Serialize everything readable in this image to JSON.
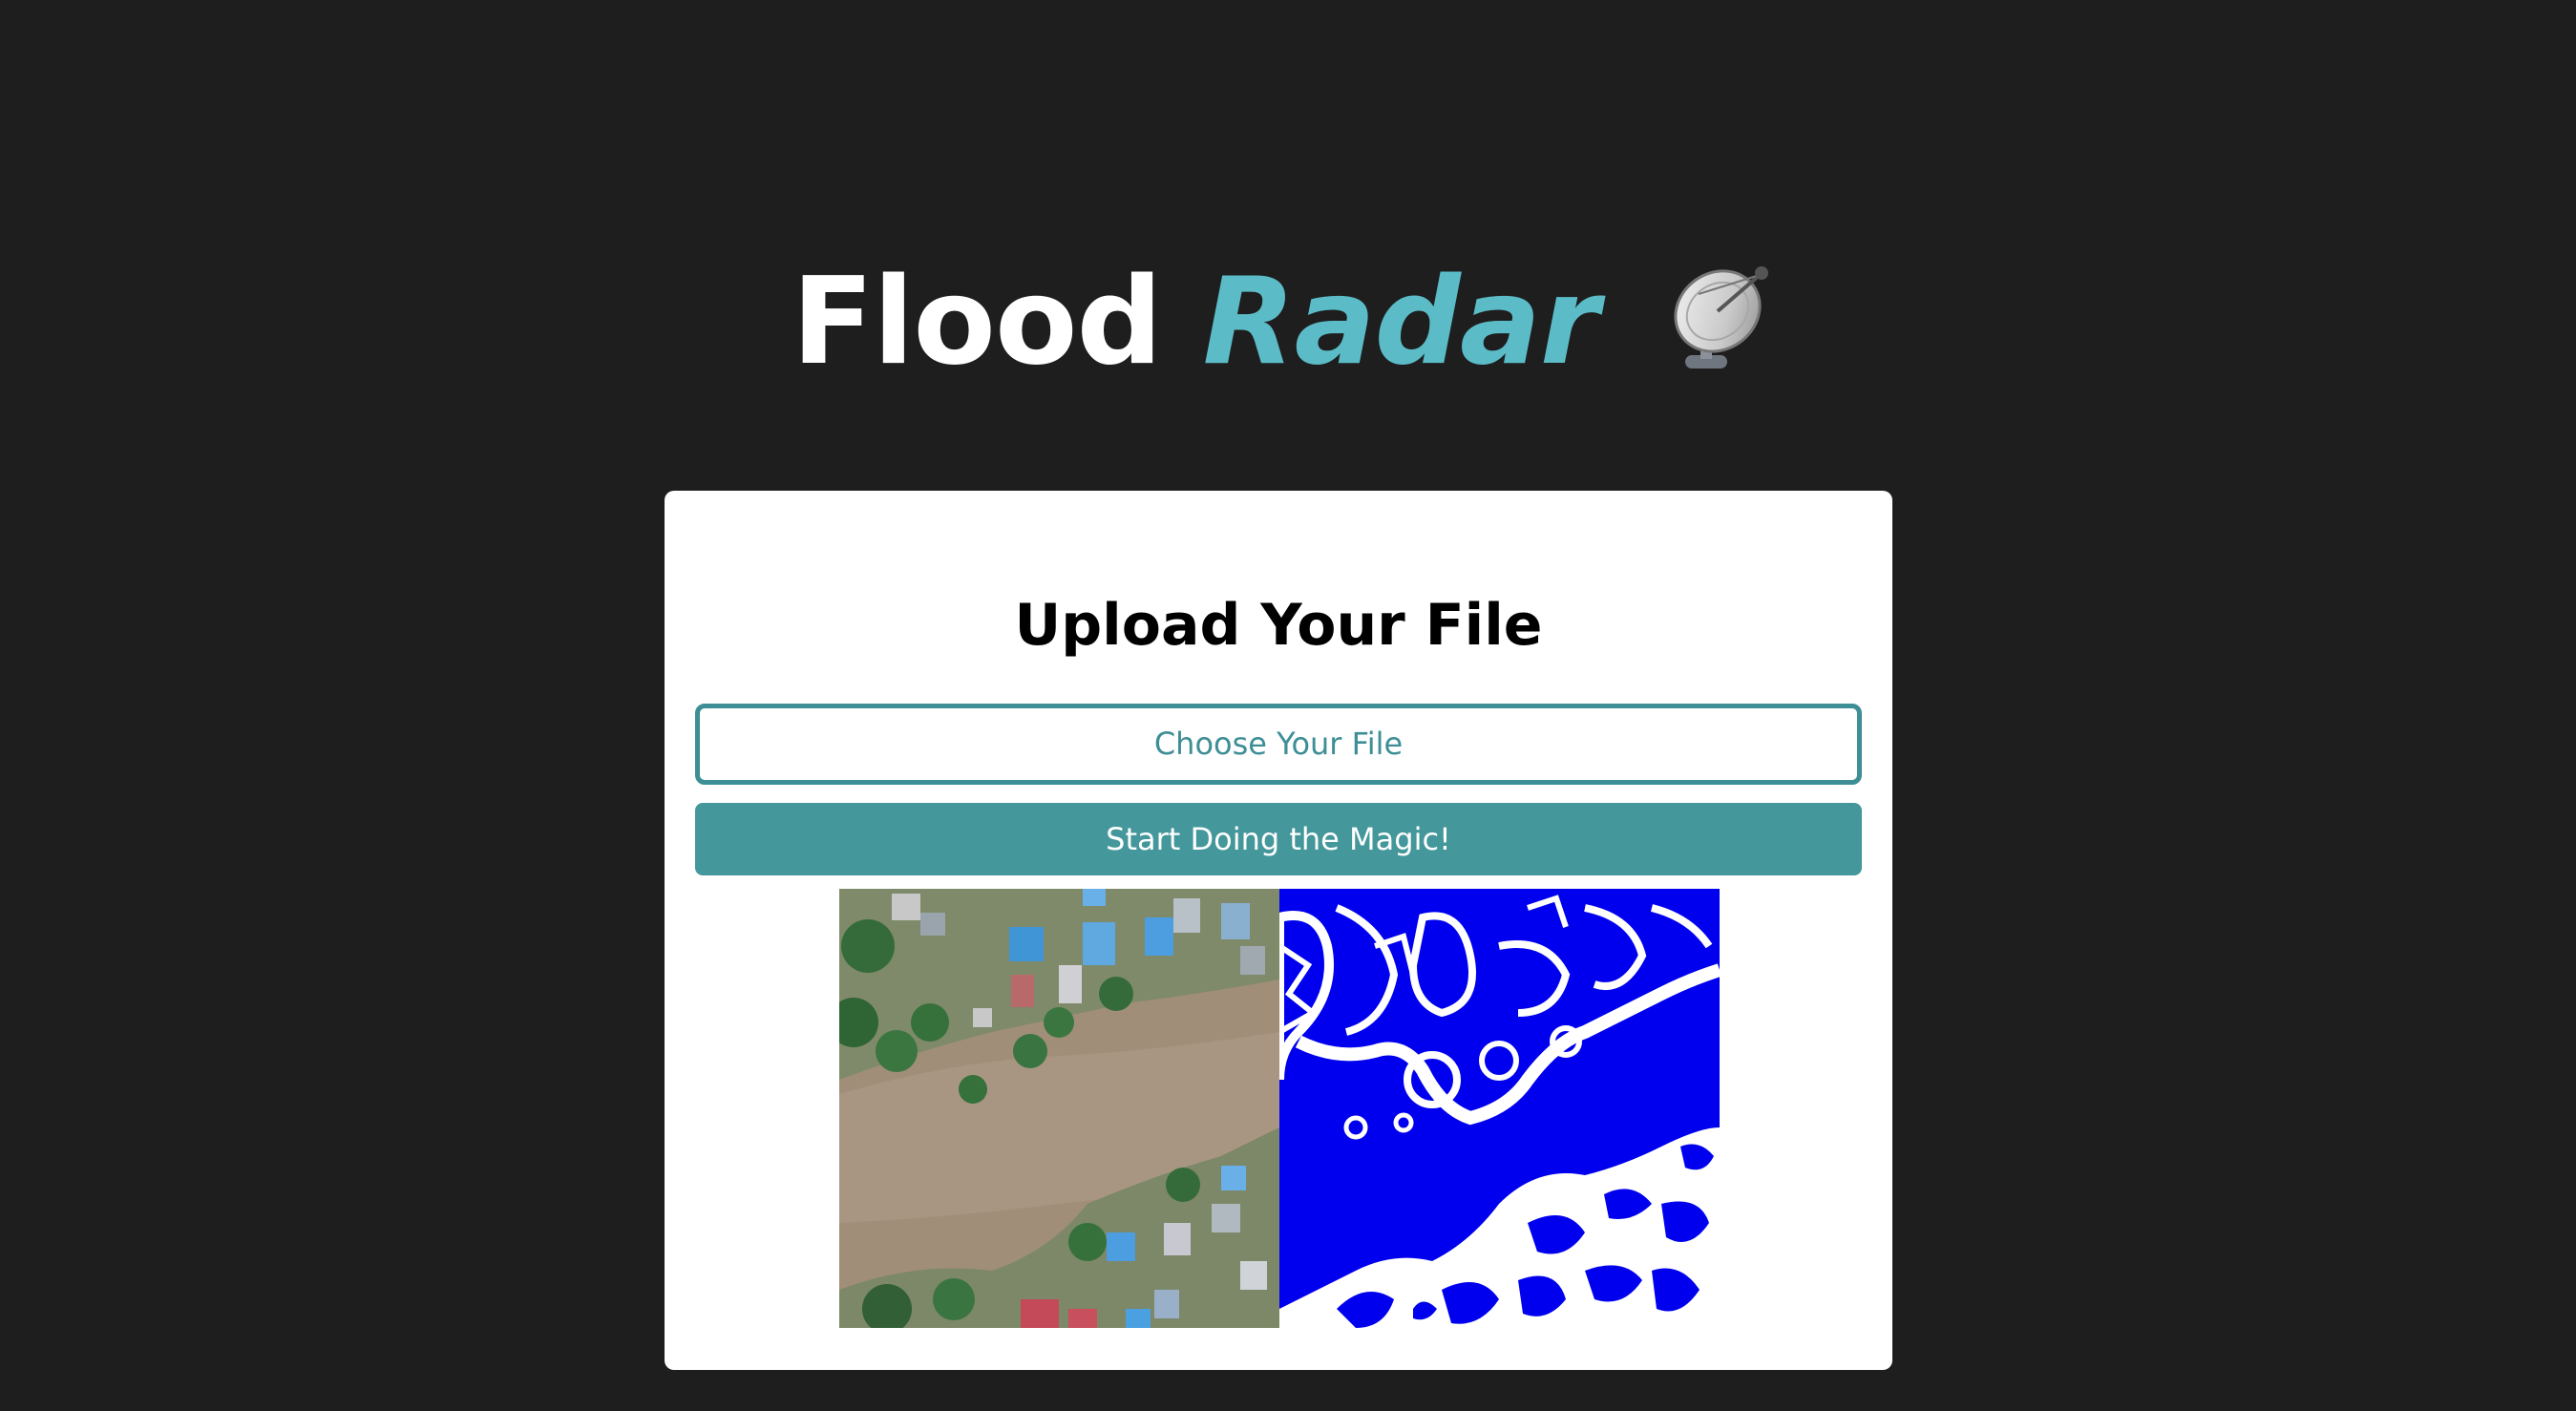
{
  "header": {
    "title_plain": "Flood",
    "title_accent": "Radar",
    "icon": "satellite-dish-icon"
  },
  "upload_card": {
    "title": "Upload Your File",
    "file_input_label": "Choose Your File",
    "submit_label": "Start Doing the Magic!"
  },
  "result": {
    "original_image": "aerial-flood-photo",
    "mask_image": "flood-segmentation-mask"
  },
  "colors": {
    "page_background": "#1e1e1e",
    "accent": "#5bbcc8",
    "button": "#44979b",
    "input_border": "#3e8e96",
    "mask_water": "#0000ee",
    "mask_land": "#ffffff"
  }
}
